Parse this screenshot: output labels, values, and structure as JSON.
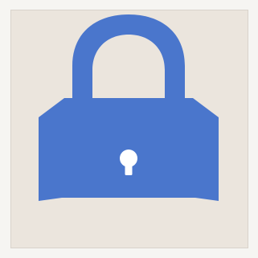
{
  "icon": {
    "name": "lock-icon",
    "state": "locked"
  },
  "colors": {
    "page_background": "#f6f5f2",
    "panel_background": "#ebe5dd",
    "panel_border": "#d9d3cb",
    "lock_fill": "#4a76cc",
    "keyhole_fill": "#ffffff"
  }
}
